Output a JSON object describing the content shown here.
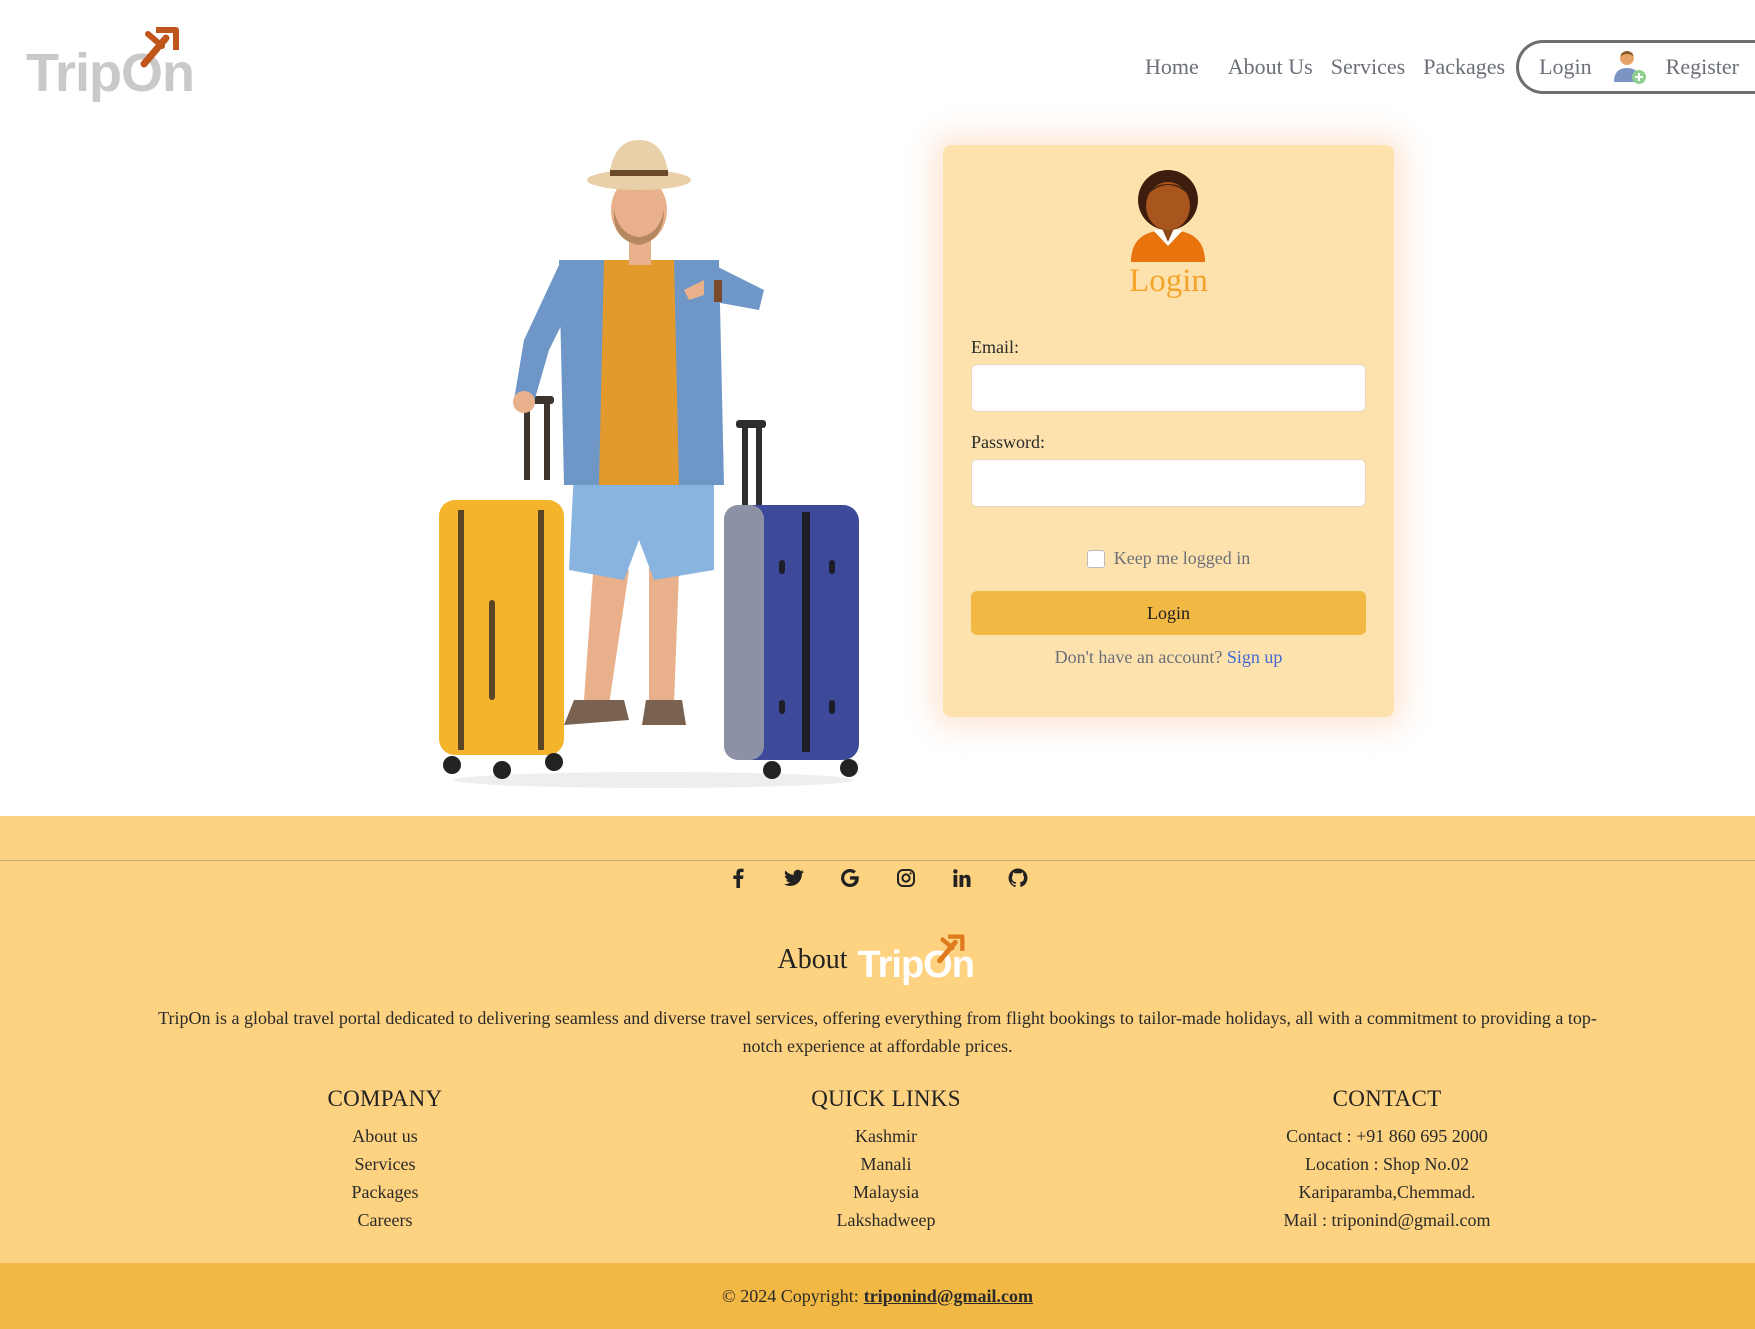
{
  "brand": {
    "name": "TripOn",
    "accent": "#e07a1f"
  },
  "nav": {
    "home": "Home",
    "about": "About Us",
    "services": "Services",
    "packages": "Packages",
    "login": "Login",
    "register": "Register"
  },
  "login_card": {
    "title": "Login",
    "email_label": "Email:",
    "email_value": "",
    "password_label": "Password:",
    "password_value": "",
    "remember_label": "Keep me logged in",
    "remember_checked": false,
    "submit_label": "Login",
    "signup_prompt": "Don't have an account?",
    "signup_link": "Sign up"
  },
  "footer": {
    "socials": [
      "facebook-icon",
      "twitter-icon",
      "google-icon",
      "instagram-icon",
      "linkedin-icon",
      "github-icon"
    ],
    "about_word": "About",
    "about_text": "TripOn is a global travel portal dedicated to delivering seamless and diverse travel services, offering everything from flight bookings to tailor-made holidays, all with a commitment to providing a top-notch experience at affordable prices.",
    "company": {
      "title": "COMPANY",
      "items": [
        "About us",
        "Services",
        "Packages",
        "Careers"
      ]
    },
    "quick_links": {
      "title": "QUICK LINKS",
      "items": [
        "Kashmir",
        "Manali",
        "Malaysia",
        "Lakshadweep"
      ]
    },
    "contact": {
      "title": "CONTACT",
      "items": [
        "Contact : +91 860 695 2000",
        "Location : Shop No.02",
        "Kariparamba,Chemmad.",
        "Mail : triponind@gmail.com"
      ]
    },
    "copyright_prefix": "© 2024 Copyright:",
    "copyright_email": "triponind@gmail.com"
  },
  "colors": {
    "card_bg": "#fee2ae",
    "footer_bg": "#fdd280",
    "button_bg": "#f2b844",
    "title_orange": "#f4a42a",
    "link_blue": "#4169d4"
  }
}
